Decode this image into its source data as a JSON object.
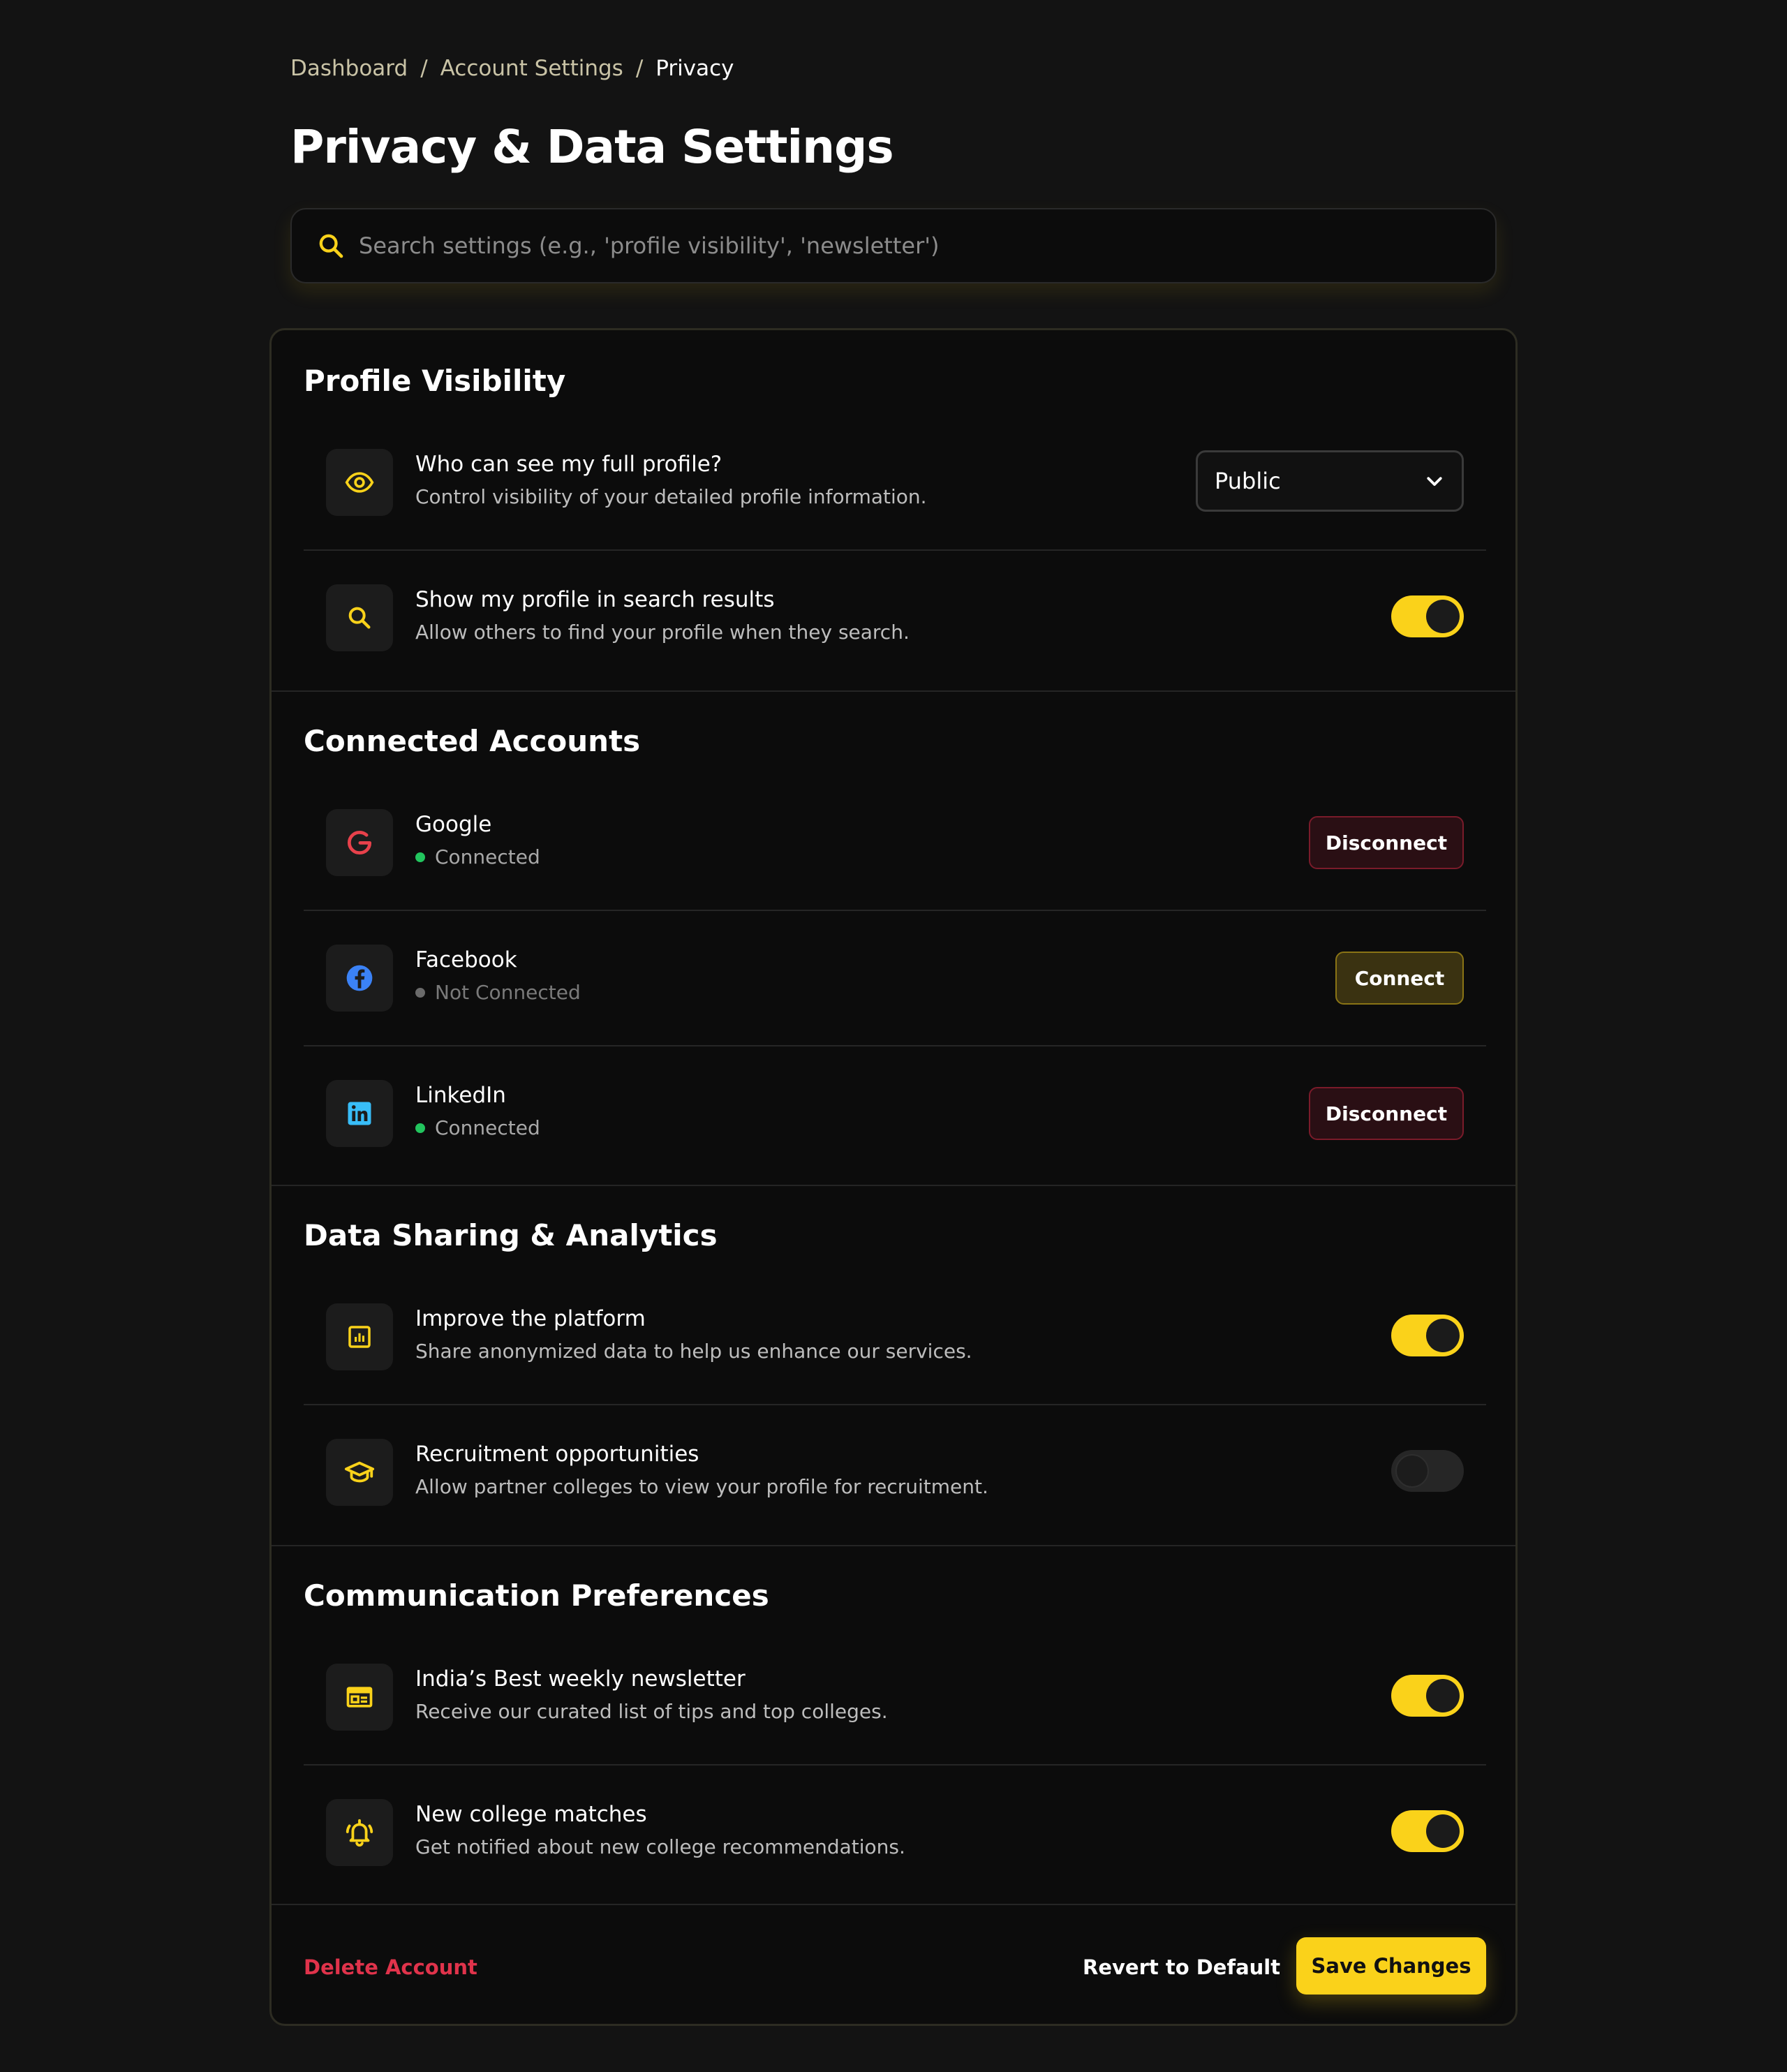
{
  "breadcrumb": {
    "items": [
      "Dashboard",
      "Account Settings",
      "Privacy"
    ],
    "separator": "/"
  },
  "page": {
    "title": "Privacy & Data Settings"
  },
  "search": {
    "placeholder": "Search settings (e.g., 'profile visibility', 'newsletter')"
  },
  "colors": {
    "accent": "#fad21a",
    "danger": "#e0334b",
    "connected": "#22c55e",
    "not_connected": "#6b6b6b"
  },
  "sections": {
    "profile_visibility": {
      "title": "Profile Visibility",
      "full_profile": {
        "icon": "eye-icon",
        "label": "Who can see my full profile?",
        "description": "Control visibility of your detailed profile information.",
        "selected": "Public"
      },
      "search_results": {
        "icon": "search-icon",
        "label": "Show my profile in search results",
        "description": "Allow others to find your profile when they search.",
        "enabled": true
      }
    },
    "connected_accounts": {
      "title": "Connected Accounts",
      "google": {
        "icon": "google-icon",
        "name": "Google",
        "status": "Connected",
        "action": "Disconnect"
      },
      "facebook": {
        "icon": "facebook-icon",
        "name": "Facebook",
        "status": "Not Connected",
        "action": "Connect"
      },
      "linkedin": {
        "icon": "linkedin-icon",
        "name": "LinkedIn",
        "status": "Connected",
        "action": "Disconnect"
      }
    },
    "data_sharing": {
      "title": "Data Sharing & Analytics",
      "improve": {
        "icon": "analytics-icon",
        "label": "Improve the platform",
        "description": "Share anonymized data to help us enhance our services.",
        "enabled": true
      },
      "recruitment": {
        "icon": "graduation-cap-icon",
        "label": "Recruitment opportunities",
        "description": "Allow partner colleges to view your profile for recruitment.",
        "enabled": false
      }
    },
    "communication": {
      "title": "Communication Preferences",
      "newsletter": {
        "icon": "newspaper-icon",
        "label": "India’s Best weekly newsletter",
        "description": "Receive our curated list of tips and top colleges.",
        "enabled": true
      },
      "college_matches": {
        "icon": "bell-icon",
        "label": "New college matches",
        "description": "Get notified about new college recommendations.",
        "enabled": true
      }
    }
  },
  "footer": {
    "delete": "Delete Account",
    "revert": "Revert to Default",
    "save": "Save Changes"
  }
}
